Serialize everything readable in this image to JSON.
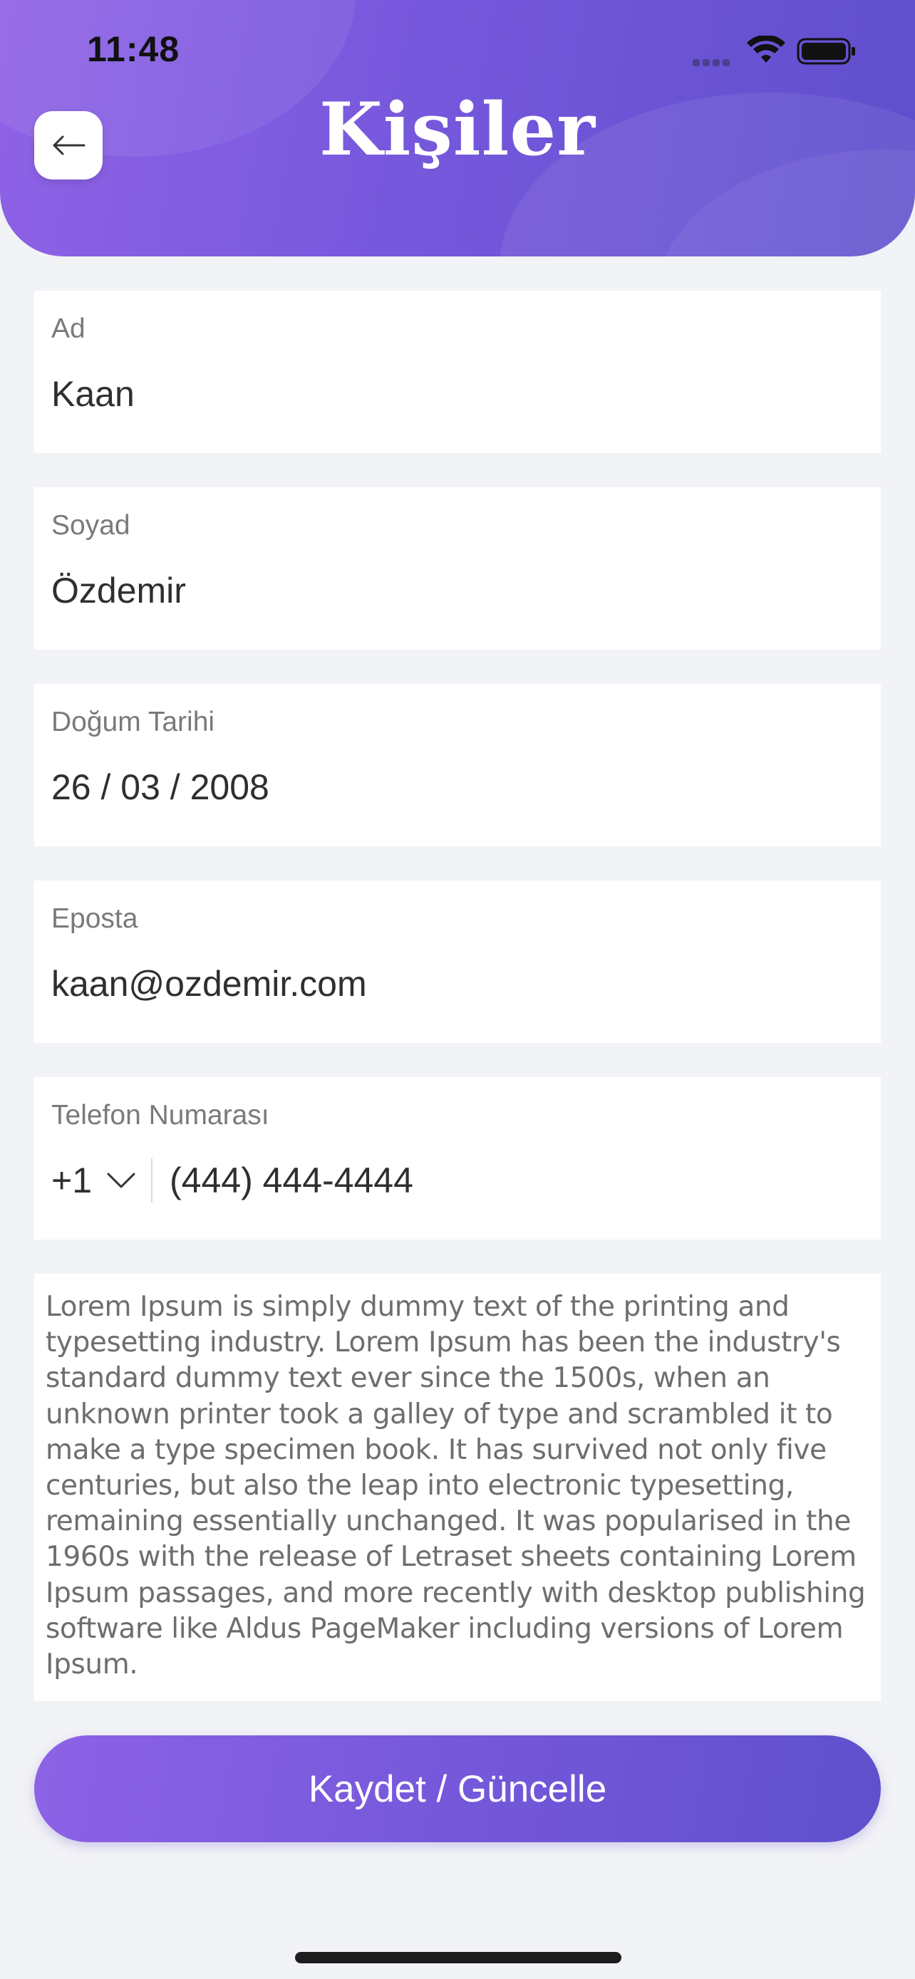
{
  "status_bar": {
    "time": "11:48",
    "icons": [
      "signal-icon",
      "wifi-icon",
      "battery-icon"
    ]
  },
  "header": {
    "title": "Kişiler",
    "back_icon": "arrow-left-icon"
  },
  "form": {
    "first_name": {
      "label": "Ad",
      "value": "Kaan"
    },
    "last_name": {
      "label": "Soyad",
      "value": "Özdemir"
    },
    "birth_date": {
      "label": "Doğum Tarihi",
      "value": "26 / 03 / 2008"
    },
    "email": {
      "label": "Eposta",
      "value": "kaan@ozdemir.com"
    },
    "phone": {
      "label": "Telefon Numarası",
      "country_code": "+1",
      "value": "(444) 444-4444"
    },
    "notes": "Lorem Ipsum is simply dummy text of the printing and\ntypesetting industry. Lorem Ipsum has been the industry's\nstandard dummy text ever since the 1500s, when an\nunknown printer took a galley of type and scrambled it to\nmake a type specimen book. It has survived not only five\ncenturies, but also the leap into electronic typesetting,\nremaining essentially unchanged. It was popularised in the\n1960s with the release of Letraset sheets containing Lorem\nIpsum passages, and more recently with desktop publishing\nsoftware like Aldus PageMaker including versions of Lorem\nIpsum."
  },
  "actions": {
    "save_label": "Kaydet / Güncelle"
  },
  "colors": {
    "header_gradient_start": "#8f62e6",
    "header_gradient_end": "#5f4fcc",
    "background": "#f2f3f7",
    "card": "#ffffff",
    "label_text": "#7a7a7a",
    "value_text": "#2f2f2f"
  }
}
